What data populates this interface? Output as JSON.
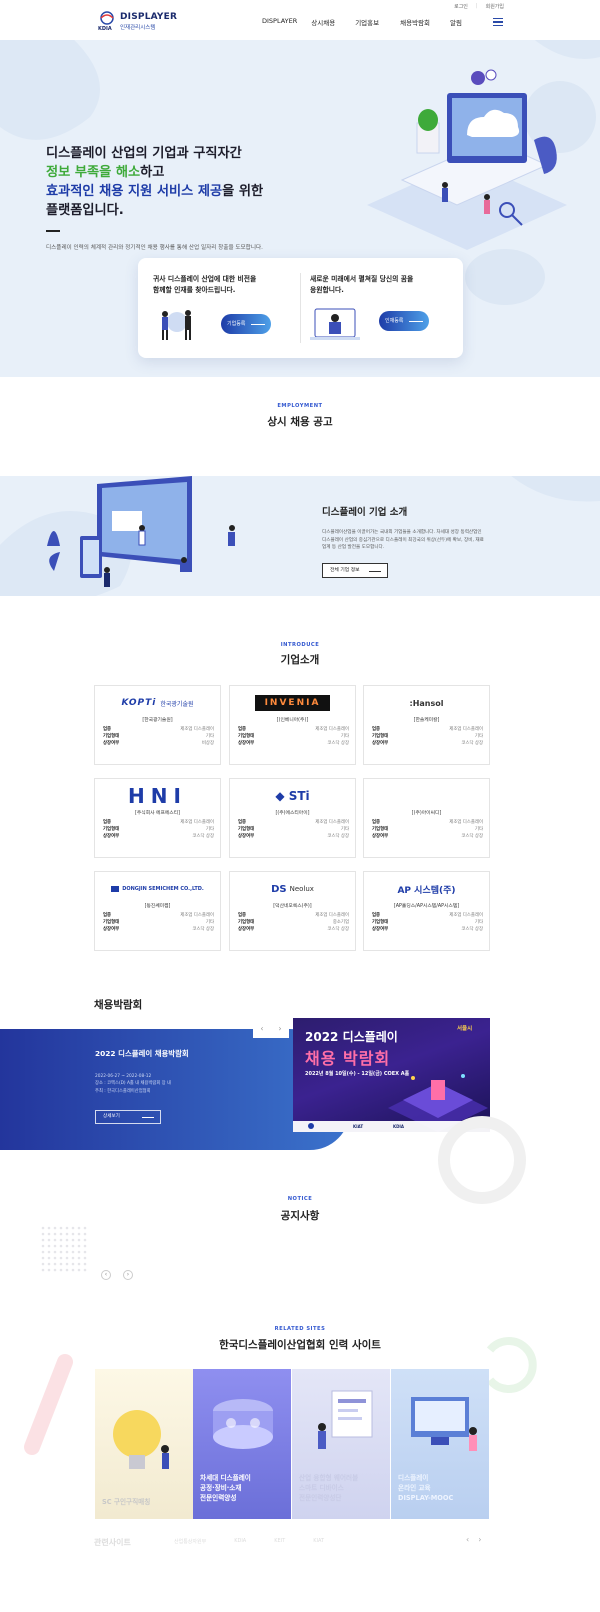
{
  "header": {
    "logo_title": "DISPLAYER",
    "logo_sub": "인재관리시스템",
    "logo_mark": "KDIA",
    "util_links": [
      "로그인",
      "회원가입"
    ],
    "nav": [
      "DISPLAYER",
      "상시채용",
      "기업홍보",
      "채용박람회",
      "알림"
    ],
    "menu_icon": "hamburger-icon"
  },
  "hero": {
    "line1": "디스플레이 산업의 기업과 구직자간",
    "line2_highlight": "정보 부족을 해소",
    "line2_rest": "하고",
    "line3_highlight": "효과적인 채용 지원 서비스 제공",
    "line3_rest": "을 위한",
    "line4": "플랫폼입니다.",
    "description": "디스플레이 인력의 체계적 관리와 정기적인 채용 행사를 통해 산업 일자리 창출을 도모합니다.",
    "accent_green": "#3eaa3a",
    "accent_blue": "#1e3ca8"
  },
  "cta": {
    "company_text_1": "귀사 디스플레이 산업에 대한 비전을",
    "company_text_2": "함께할 인재를 찾아드립니다.",
    "company_button": "기업등록",
    "talent_text_1": "새로운 미래에서 펼쳐질 당신의 꿈을",
    "talent_text_2": "응원합니다.",
    "talent_button": "인재등록"
  },
  "employment": {
    "eyebrow": "EMPLOYMENT",
    "title": "상시 채용 공고"
  },
  "intro_band": {
    "title": "디스플레이 기업 소개",
    "desc_1": "디스플레이산업을 이끌어가는 국내외 기업들을 소개합니다. 차세대 성장 동력산업인",
    "desc_2": "디스플레이 산업의 중심기관으로 디스플레이 최강국의 위상(선두)에 확보, 장비, 재료",
    "desc_3": "업계 등 산업 발전을 도모합니다.",
    "button": "전체 기업 정보"
  },
  "introduce": {
    "eyebrow": "INTRODUCE",
    "title": "기업소개",
    "field_labels": [
      "업종",
      "기업형태",
      "상장여부"
    ],
    "companies": [
      {
        "logo": "KOPTI 한국광기술원",
        "name": "[한국광기술원]",
        "values": [
          "제조업 디스플레이",
          "기타",
          "비상장"
        ]
      },
      {
        "logo": "INVENIA",
        "name": "[(인베니아(주)]",
        "values": [
          "제조업 디스플레이",
          "기타",
          "코스닥 상장"
        ]
      },
      {
        "logo": "Hansol",
        "name": "[한솔케미칼]",
        "values": [
          "제조업 디스플레이",
          "기타",
          "코스닥 상장"
        ]
      },
      {
        "logo": "HNI",
        "name": "[주식회사 에프에스티]",
        "values": [
          "제조업 디스플레이",
          "기타",
          "코스닥 상장"
        ]
      },
      {
        "logo": "STi",
        "name": "[(주)에스티아이]",
        "values": [
          "제조업 디스플레이",
          "기타",
          "코스닥 상장"
        ]
      },
      {
        "logo": "",
        "name": "[(주)아이씨디]",
        "values": [
          "제조업 디스플레이",
          "기타",
          "코스닥 상장"
        ]
      },
      {
        "logo": "DONGJIN SEMICHEM CO.,LTD.",
        "name": "[동진쎄미켐]",
        "values": [
          "제조업 디스플레이",
          "기타",
          "코스닥 상장"
        ]
      },
      {
        "logo": "DS Neolux",
        "name": "[덕산네오룩스(주)]",
        "values": [
          "제조업 디스플레이",
          "중소기업",
          "코스닥 상장"
        ]
      },
      {
        "logo": "AP 시스템(주)",
        "name": "[AP홀딩스/AP시스템/AP시스템]",
        "values": [
          "제조업 디스플레이",
          "기타",
          "코스닥 상장"
        ]
      }
    ]
  },
  "job_fair": {
    "title": "채용박람회",
    "arrows": [
      "‹",
      "›"
    ],
    "fair_name": "2022 디스플레이 채용박람회",
    "date": "2022-06-27 ~ 2022-08-12",
    "place": "장소 : 코엑스(D) A홀 내 채용박람회 장 내",
    "host": "주최 : 한국디스플레이산업협회",
    "button": "상세보기",
    "poster_line1": "2022 디스플레이",
    "poster_line2": "채용 박람회",
    "poster_line3": "2022년 8월 10일(수) - 12일(금) COEX A홀",
    "poster_badge": "서울시",
    "poster_colors": [
      "#2d1d6e",
      "#ff6fa8"
    ]
  },
  "notice": {
    "eyebrow": "NOTICE",
    "title": "공지사항",
    "arrows": [
      "‹",
      "›"
    ]
  },
  "related": {
    "eyebrow": "RELATED SITES",
    "title": "한국디스플레이산업협회 인력 사이트",
    "tiles": [
      {
        "lines": [
          "SC 구인구직매칭"
        ]
      },
      {
        "lines": [
          "차세대 디스플레이",
          "공정·장비·소재",
          "전문인력양성"
        ]
      },
      {
        "lines": [
          "산업 융합형 웨어러블",
          "스마트 디바이스",
          "전문인력양성단"
        ]
      },
      {
        "lines": [
          "디스플레이",
          "온라인 교육",
          "DISPLAY-MOOC"
        ]
      }
    ]
  },
  "footer": {
    "title": "관련사이트",
    "logos": [
      "산업통상자원부",
      "KDIA",
      "KEIT",
      "KIAT"
    ],
    "arrows": [
      "‹",
      "›"
    ]
  }
}
